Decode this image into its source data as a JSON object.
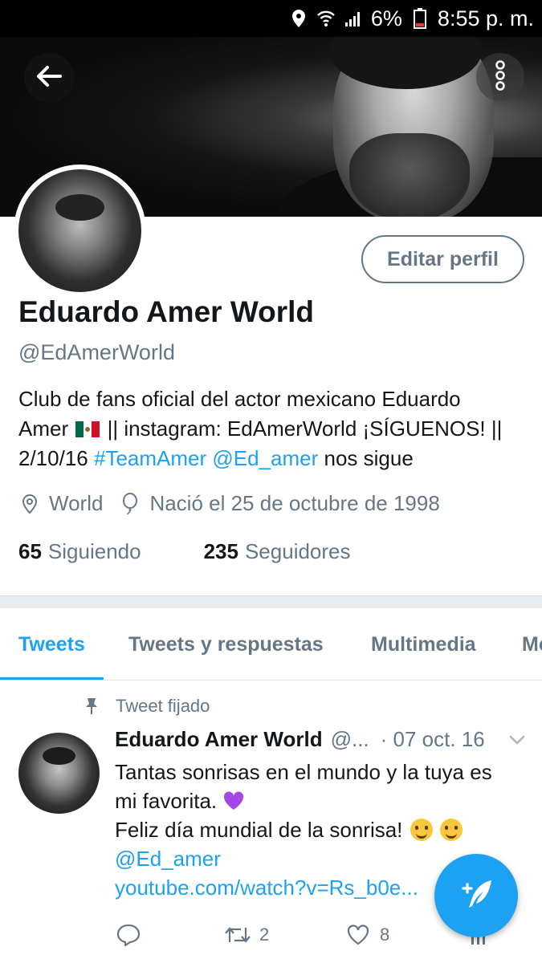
{
  "status_bar": {
    "battery": "6%",
    "time": "8:55 p. m."
  },
  "profile": {
    "name": "Eduardo Amer World",
    "handle": "@EdAmerWorld",
    "edit_button": "Editar perfil",
    "bio": {
      "line1": "Club de fans oficial del actor mexicano Eduardo",
      "line2_pre": "Amer",
      "line2_post": "|| instagram: EdAmerWorld ¡SÍGUENOS! ||",
      "line3_pre": "2/10/16",
      "hashtag": "#TeamAmer",
      "mention": "@Ed_amer",
      "line3_post": "nos sigue"
    },
    "location": "World",
    "birthday": "Nació el 25 de octubre de 1998",
    "following_count": "65",
    "following_label": "Siguiendo",
    "followers_count": "235",
    "followers_label": "Seguidores"
  },
  "tabs": [
    {
      "label": "Tweets",
      "active": true
    },
    {
      "label": "Tweets y respuestas",
      "active": false
    },
    {
      "label": "Multimedia",
      "active": false
    },
    {
      "label": "Me",
      "active": false
    }
  ],
  "tweet": {
    "pinned_label": "Tweet fijado",
    "author": "Eduardo Amer World",
    "handle": "@...",
    "date": "· 07 oct. 16",
    "line1": "Tantas sonrisas en el mundo y la tuya es",
    "line2": "mi favorita.",
    "line3": "Feliz día mundial de la sonrisa!",
    "mention": "@Ed_amer",
    "url": "youtube.com/watch?v=Rs_b0e...",
    "retweets": "2",
    "likes": "8"
  },
  "colors": {
    "accent": "#1da1f2",
    "muted": "#657786",
    "text": "#14171a"
  },
  "icons": [
    "location-icon",
    "wifi-icon",
    "signal-icon",
    "battery-icon",
    "back-arrow-icon",
    "more-vertical-icon",
    "map-pin-icon",
    "balloon-icon",
    "pin-icon",
    "chevron-down-icon",
    "reply-icon",
    "retweet-icon",
    "heart-icon",
    "analytics-icon",
    "compose-icon"
  ]
}
